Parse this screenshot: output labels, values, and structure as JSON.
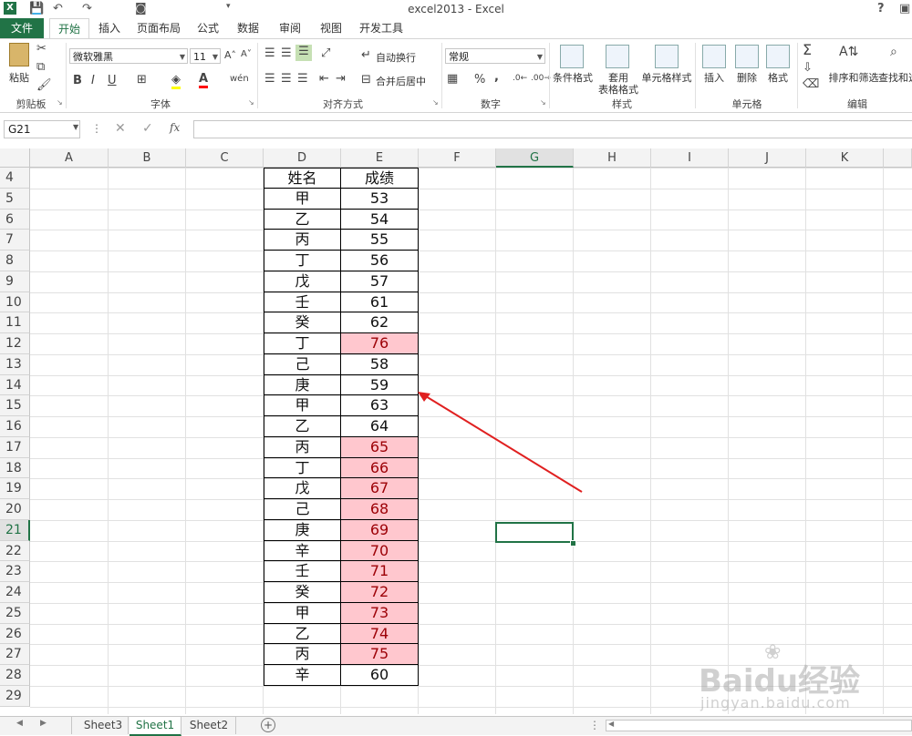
{
  "window": {
    "title": "excel2013 - Excel",
    "help": "?"
  },
  "tabs": [
    "文件",
    "开始",
    "插入",
    "页面布局",
    "公式",
    "数据",
    "审阅",
    "视图",
    "开发工具"
  ],
  "ribbon": {
    "clipboard": {
      "paste": "粘贴",
      "label": "剪贴板"
    },
    "font": {
      "name": "微软雅黑",
      "size": "11",
      "bold": "B",
      "italic": "I",
      "underline": "U",
      "label": "字体"
    },
    "alignment": {
      "wrap": "自动换行",
      "merge": "合并后居中",
      "label": "对齐方式"
    },
    "number": {
      "format": "常规",
      "percent": "%",
      "comma": ",",
      "label": "数字"
    },
    "styles": {
      "conditional": "条件格式",
      "table_line1": "套用",
      "table_line2": "表格格式",
      "cell_styles": "单元格样式",
      "label": "样式"
    },
    "cells": {
      "insert": "插入",
      "delete": "删除",
      "format": "格式",
      "label": "单元格"
    },
    "editing": {
      "sum_icon": "Σ",
      "sort": "排序和筛选",
      "find": "查找和选",
      "label": "编辑"
    }
  },
  "formula_bar": {
    "name_box": "G21",
    "fx": "fx",
    "value": ""
  },
  "columns": [
    "A",
    "B",
    "C",
    "D",
    "E",
    "F",
    "G",
    "H",
    "I",
    "J",
    "K"
  ],
  "selected_column": "G",
  "selected_row": "21",
  "rows": [
    "4",
    "5",
    "6",
    "7",
    "8",
    "9",
    "10",
    "11",
    "12",
    "13",
    "14",
    "15",
    "16",
    "17",
    "18",
    "19",
    "20",
    "21",
    "22",
    "23",
    "24",
    "25",
    "26",
    "27",
    "28",
    "29"
  ],
  "table": {
    "header": {
      "name": "姓名",
      "score": "成绩"
    },
    "records": [
      {
        "name": "甲",
        "score": "53",
        "highlight": false
      },
      {
        "name": "乙",
        "score": "54",
        "highlight": false
      },
      {
        "name": "丙",
        "score": "55",
        "highlight": false
      },
      {
        "name": "丁",
        "score": "56",
        "highlight": false
      },
      {
        "name": "戊",
        "score": "57",
        "highlight": false
      },
      {
        "name": "壬",
        "score": "61",
        "highlight": false
      },
      {
        "name": "癸",
        "score": "62",
        "highlight": false
      },
      {
        "name": "丁",
        "score": "76",
        "highlight": true
      },
      {
        "name": "己",
        "score": "58",
        "highlight": false
      },
      {
        "name": "庚",
        "score": "59",
        "highlight": false
      },
      {
        "name": "甲",
        "score": "63",
        "highlight": false
      },
      {
        "name": "乙",
        "score": "64",
        "highlight": false
      },
      {
        "name": "丙",
        "score": "65",
        "highlight": true
      },
      {
        "name": "丁",
        "score": "66",
        "highlight": true
      },
      {
        "name": "戊",
        "score": "67",
        "highlight": true
      },
      {
        "name": "己",
        "score": "68",
        "highlight": true
      },
      {
        "name": "庚",
        "score": "69",
        "highlight": true
      },
      {
        "name": "辛",
        "score": "70",
        "highlight": true
      },
      {
        "name": "壬",
        "score": "71",
        "highlight": true
      },
      {
        "name": "癸",
        "score": "72",
        "highlight": true
      },
      {
        "name": "甲",
        "score": "73",
        "highlight": true
      },
      {
        "name": "乙",
        "score": "74",
        "highlight": true
      },
      {
        "name": "丙",
        "score": "75",
        "highlight": true
      },
      {
        "name": "辛",
        "score": "60",
        "highlight": false
      }
    ]
  },
  "sheets": [
    {
      "name": "Sheet3",
      "active": false
    },
    {
      "name": "Sheet1",
      "active": true
    },
    {
      "name": "Sheet2",
      "active": false
    }
  ],
  "watermark": {
    "brand": "Baidu经验",
    "url": "jingyan.baidu.com"
  },
  "colors": {
    "excel_green": "#217346",
    "highlight_fill": "#ffc7ce",
    "highlight_text": "#9c0006",
    "arrow": "#e02020"
  }
}
